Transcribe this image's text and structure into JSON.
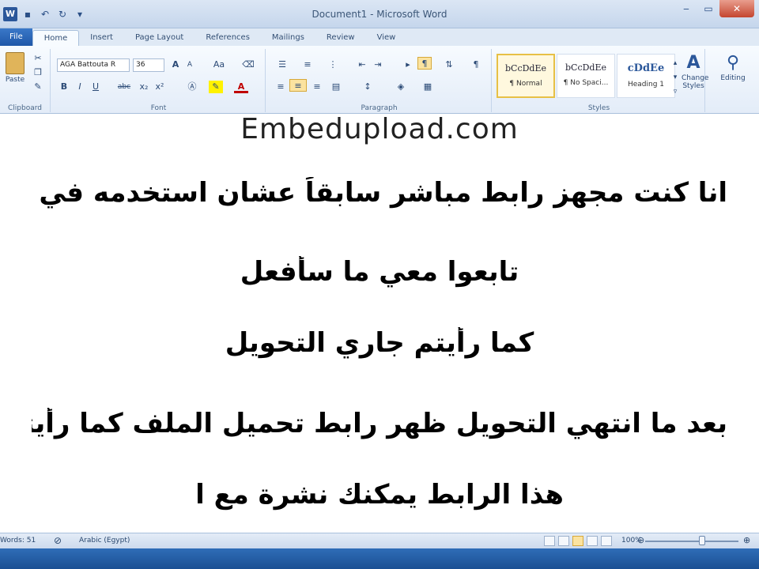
{
  "window": {
    "title": "Document1 - Microsoft Word",
    "app_letter": "W"
  },
  "tabs": [
    {
      "label": "File"
    },
    {
      "label": "Home"
    },
    {
      "label": "Insert"
    },
    {
      "label": "Page Layout"
    },
    {
      "label": "References"
    },
    {
      "label": "Mailings"
    },
    {
      "label": "Review"
    },
    {
      "label": "View"
    }
  ],
  "ribbon": {
    "clipboard": {
      "label": "Clipboard",
      "paste": "Paste"
    },
    "font": {
      "label": "Font",
      "font_name": "AGA Battouta R",
      "font_size": "36",
      "grow": "A",
      "shrink": "A",
      "case": "Aa",
      "bold": "B",
      "italic": "I",
      "underline": "U",
      "strike": "abc",
      "sub": "x₂",
      "sup": "x²",
      "color": "A"
    },
    "paragraph": {
      "label": "Paragraph",
      "pilcrow": "¶"
    },
    "styles": {
      "label": "Styles",
      "items": [
        {
          "sample": "bCcDdEe",
          "name": "¶ Normal"
        },
        {
          "sample": "bCcDdEe",
          "name": "¶ No Spaci..."
        },
        {
          "sample": "cDdEe",
          "name": "Heading 1"
        }
      ],
      "change_styles": "Change Styles"
    },
    "editing": {
      "label": "Editing"
    }
  },
  "document": {
    "watermark": "Embedupload.com",
    "lines": [
      "انا كنت مجهز رابط مباشر سابقاً عشان استخدمه في الشرح",
      "تابعوا معي ما سأفعل",
      "كما رأيتم جاري التحويل",
      "بعد ما انتهي التحويل ظهر رابط تحميل الملف كما رأيتم",
      "هذا الرابط يمكنك نشرة مع ا"
    ]
  },
  "status": {
    "words": "Words: 51",
    "language": "Arabic (Egypt)",
    "zoom": "100%"
  }
}
